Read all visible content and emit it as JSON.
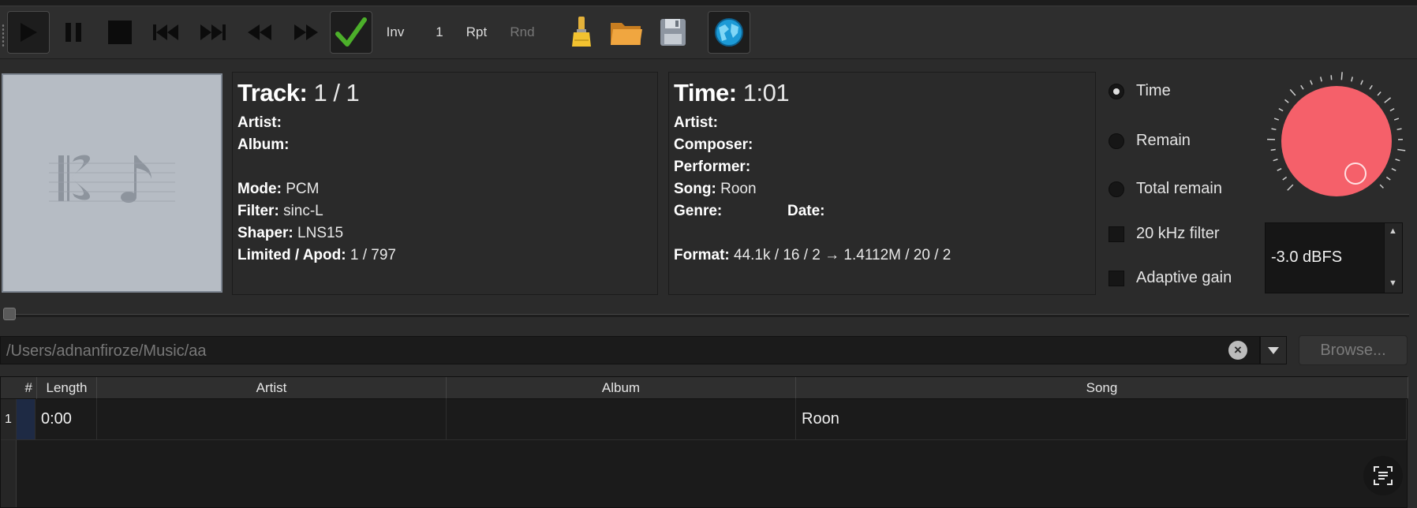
{
  "toolbar": {
    "inv_label": "Inv",
    "one_label": "1",
    "rpt_label": "Rpt",
    "rnd_label": "Rnd"
  },
  "track_panel": {
    "track_label": "Track:",
    "track_value": "1 / 1",
    "artist_label": "Artist:",
    "album_label": "Album:",
    "mode_label": "Mode:",
    "mode_value": "PCM",
    "filter_label": "Filter:",
    "filter_value": "sinc-L",
    "shaper_label": "Shaper:",
    "shaper_value": "LNS15",
    "limited_label": "Limited / Apod:",
    "limited_value": "1 / 797"
  },
  "time_panel": {
    "time_label": "Time:",
    "time_value": "1:01",
    "artist_label": "Artist:",
    "composer_label": "Composer:",
    "performer_label": "Performer:",
    "song_label": "Song:",
    "song_value": "Roon",
    "genre_label": "Genre:",
    "date_label": "Date:",
    "format_label": "Format:",
    "format_value": "44.1k / 16 / 2 → 1.4112M / 20 / 2"
  },
  "display_options": {
    "time": "Time",
    "remain": "Remain",
    "total_remain": "Total remain",
    "selected": "Time"
  },
  "filters": {
    "khz_filter": "20 kHz filter",
    "adaptive_gain": "Adaptive gain"
  },
  "volume": {
    "value": "-3.0 dBFS",
    "knob_color": "#f5606a"
  },
  "seek": {
    "fraction": 0.0
  },
  "path": {
    "value": "/Users/adnanfiroze/Music/aa",
    "browse_label": "Browse..."
  },
  "table": {
    "columns": [
      "#",
      "Length",
      "Artist",
      "Album",
      "Song"
    ],
    "rows": [
      {
        "num": "1",
        "length": "0:00",
        "artist": "",
        "album": "",
        "song": "Roon"
      }
    ]
  },
  "colors": {
    "background": "#2b2b2b",
    "panel": "#2a2a2a",
    "check_green": "#4caf2a",
    "folder": "#e8a23c"
  }
}
